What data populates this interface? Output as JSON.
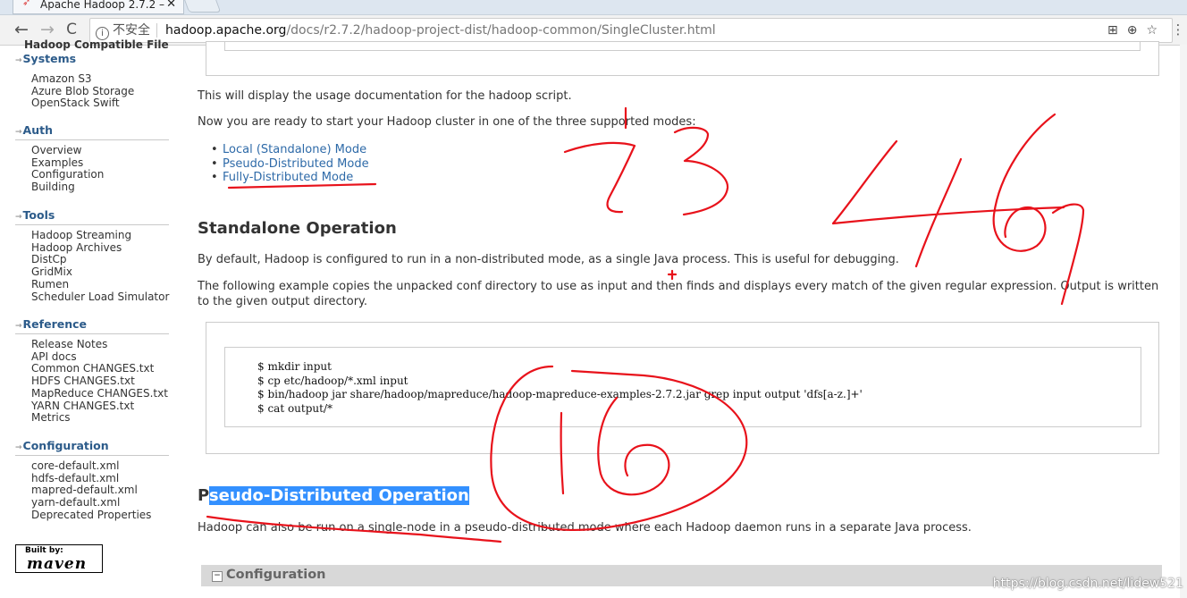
{
  "browser": {
    "tab_title": "Apache Hadoop 2.7.2 –",
    "tab_close": "✕",
    "nav_back": "←",
    "nav_forward": "→",
    "nav_reload": "C",
    "security_label": "不安全",
    "url_host": "hadoop.apache.org",
    "url_path": "/docs/r2.7.2/hadoop-project-dist/hadoop-common/SingleCluster.html",
    "actions": [
      "translate-icon",
      "zoom-icon",
      "bookmark-star-icon",
      "menu-icon"
    ]
  },
  "sidebar": {
    "cut_heading": "Hadoop Compatible File",
    "sections": [
      {
        "title": "Systems",
        "items": [
          "Amazon S3",
          "Azure Blob Storage",
          "OpenStack Swift"
        ]
      },
      {
        "title": "Auth",
        "items": [
          "Overview",
          "Examples",
          "Configuration",
          "Building"
        ]
      },
      {
        "title": "Tools",
        "items": [
          "Hadoop Streaming",
          "Hadoop Archives",
          "DistCp",
          "GridMix",
          "Rumen",
          "Scheduler Load Simulator"
        ]
      },
      {
        "title": "Reference",
        "items": [
          "Release Notes",
          "API docs",
          "Common CHANGES.txt",
          "HDFS CHANGES.txt",
          "MapReduce CHANGES.txt",
          "YARN CHANGES.txt",
          "Metrics"
        ]
      },
      {
        "title": "Configuration",
        "items": [
          "core-default.xml",
          "hdfs-default.xml",
          "mapred-default.xml",
          "yarn-default.xml",
          "Deprecated Properties"
        ]
      }
    ],
    "badge_line1": "Built by:",
    "badge_line2": "maven"
  },
  "content": {
    "usage_text": "This will display the usage documentation for the hadoop script.",
    "modes_intro": "Now you are ready to start your Hadoop cluster in one of the three supported modes:",
    "modes": [
      "Local (Standalone) Mode",
      "Pseudo-Distributed Mode",
      "Fully-Distributed Mode"
    ],
    "standalone_heading": "Standalone Operation",
    "standalone_p1": "By default, Hadoop is configured to run in a non-distributed mode, as a single Java process. This is useful for debugging.",
    "standalone_p2a": "The following example copies the unpacked conf directory to use as input and then finds and displays every match of the given regular expression. Output is written",
    "standalone_p2b": "to the given output directory.",
    "code_lines": [
      "$ mkdir input",
      "$ cp etc/hadoop/*.xml input",
      "$ bin/hadoop jar share/hadoop/mapreduce/hadoop-mapreduce-examples-2.7.2.jar grep input output 'dfs[a-z.]+'",
      "$ cat output/*"
    ],
    "pseudo_heading_first": "P",
    "pseudo_heading_rest": "seudo-Distributed Operation",
    "pseudo_p1": "Hadoop can also be run on a single-node in a pseudo-distributed mode where each Hadoop daemon runs in a separate Java process.",
    "config_bar_icon": "−",
    "config_bar": "Configuration"
  },
  "annotations": {
    "handwritten_numbers": [
      "73",
      "46",
      "16"
    ],
    "color": "#e8121b"
  },
  "watermark": "https://blog.csdn.net/lidew521"
}
